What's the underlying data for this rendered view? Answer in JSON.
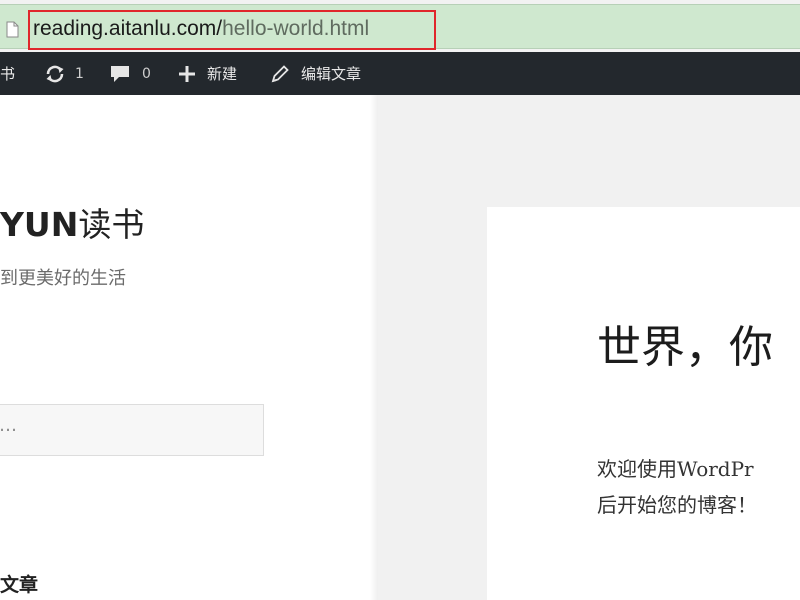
{
  "browser": {
    "url_host": "reading.aitanlu.com/",
    "url_path": "hello-world.html",
    "highlight_color": "#e0262b",
    "address_bg": "#cfe8cf"
  },
  "admin_bar": {
    "site_label": "书",
    "updates_count": "1",
    "comments_count": "0",
    "new_label": "新建",
    "edit_label": "编辑文章",
    "background": "#23282d"
  },
  "sidebar": {
    "site_title_latin": "YUN",
    "site_title_cn": "读书",
    "tagline": "到更美好的生活",
    "search_placeholder": "…",
    "widget_heading": "文章"
  },
  "post": {
    "title": "世界，你",
    "excerpt_line1": "欢迎使用WordPr",
    "excerpt_line2": "后开始您的博客！"
  },
  "icons": [
    "page-icon",
    "updates-icon",
    "comment-icon",
    "plus-icon",
    "pencil-icon"
  ]
}
